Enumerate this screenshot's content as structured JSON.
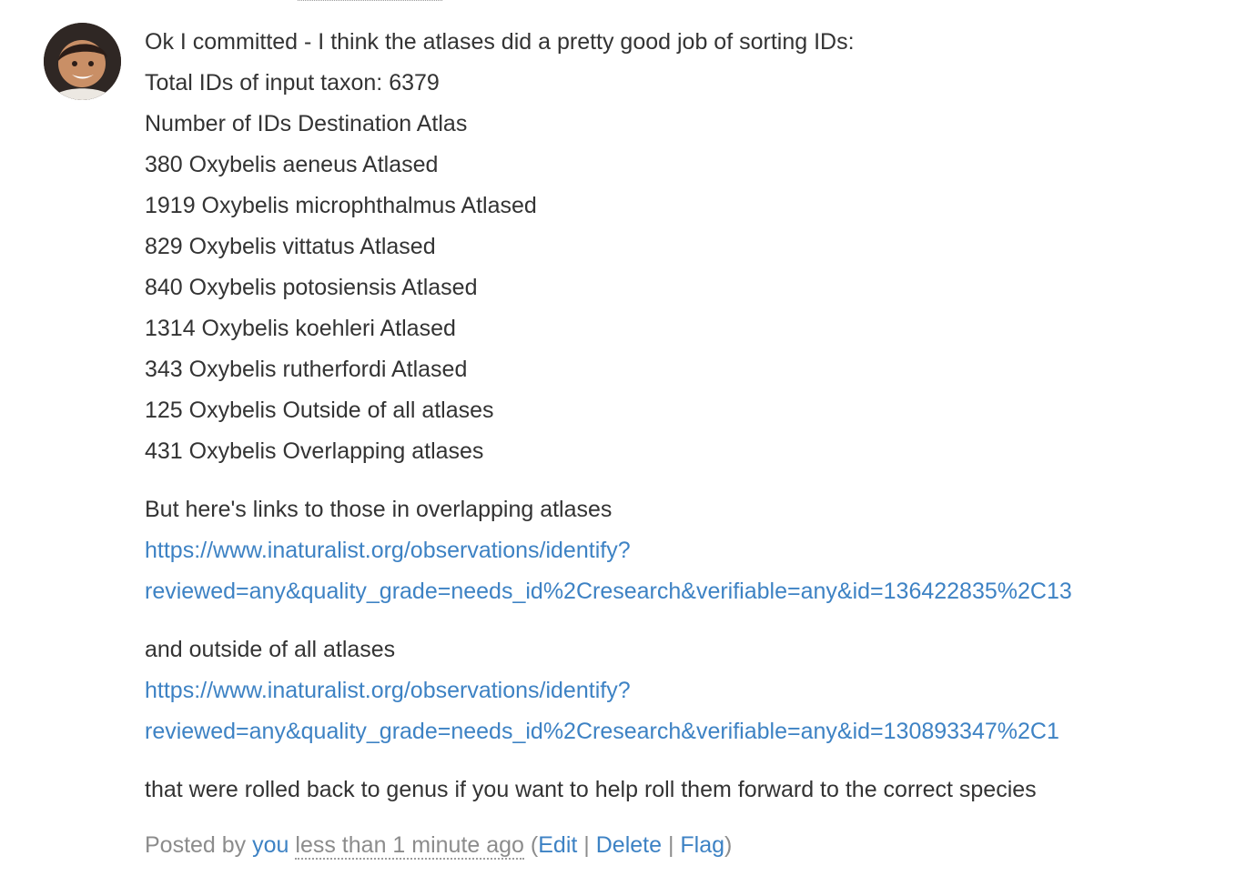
{
  "comment": {
    "lines": [
      "Ok I committed - I think the atlases did a pretty good job of sorting IDs:",
      "Total IDs of input taxon: 6379",
      "Number of IDs Destination Atlas",
      "380 Oxybelis aeneus Atlased",
      "1919 Oxybelis microphthalmus Atlased",
      "829 Oxybelis vittatus Atlased",
      "840 Oxybelis potosiensis Atlased",
      "1314 Oxybelis koehleri Atlased",
      "343 Oxybelis rutherfordi Atlased",
      "125 Oxybelis Outside of all atlases",
      "431 Oxybelis Overlapping atlases"
    ],
    "overlapping_intro": "But here's links to those in overlapping atlases",
    "overlapping_link": {
      "line1": "https://www.inaturalist.org/observations/identify?",
      "line2": "reviewed=any&quality_grade=needs_id%2Cresearch&verifiable=any&id=136422835%2C13"
    },
    "outside_intro": "and outside of all atlases",
    "outside_link": {
      "line1": "https://www.inaturalist.org/observations/identify?",
      "line2": "reviewed=any&quality_grade=needs_id%2Cresearch&verifiable=any&id=130893347%2C1"
    },
    "closing": "that were rolled back to genus if you want to help roll them forward to the correct species"
  },
  "footer": {
    "posted_by": "Posted by ",
    "author": "you",
    "time": "less than 1 minute ago",
    "open_paren": " (",
    "edit": "Edit",
    "sep1": " | ",
    "delete": "Delete",
    "sep2": " | ",
    "flag": "Flag",
    "close_paren": ")"
  },
  "avatar": {
    "icon": "user-avatar-photo"
  }
}
